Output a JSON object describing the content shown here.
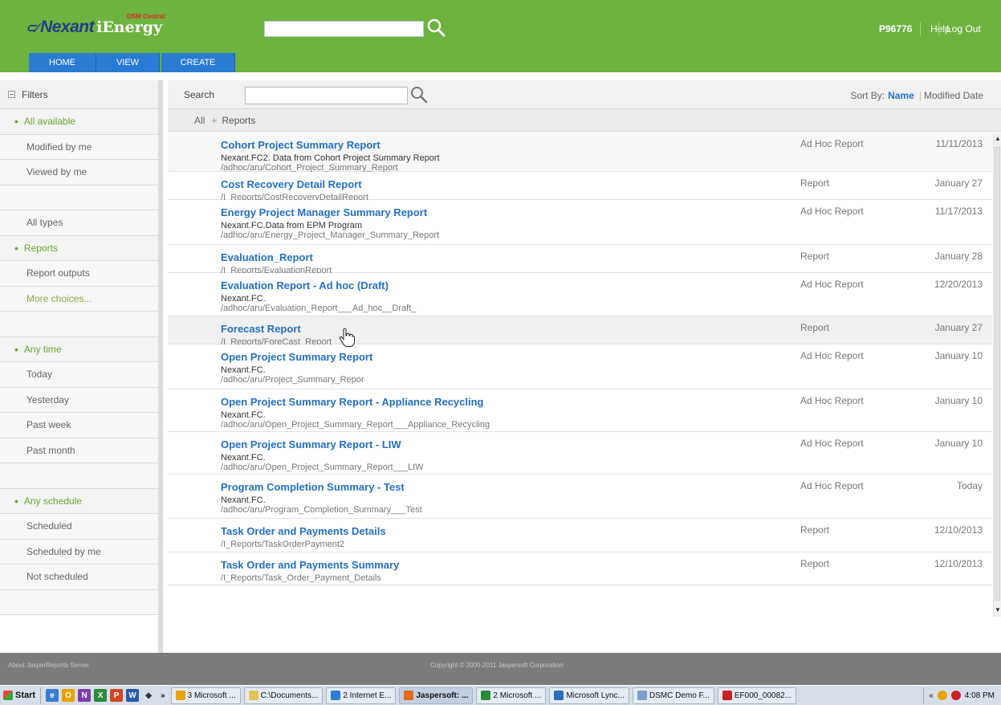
{
  "header": {
    "logo_brand": "Nexant",
    "logo_product": "iEnergy",
    "logo_tagline": "DSM Central",
    "user_id": "P96776",
    "help_label": "Help",
    "logout_label": "Log Out",
    "search_value": "",
    "brand_color": "#6db33f"
  },
  "tabs": [
    {
      "label": "HOME"
    },
    {
      "label": "VIEW"
    },
    {
      "label": "CREATE"
    }
  ],
  "filters": {
    "title": "Filters",
    "group1": [
      "All available",
      "Modified by me",
      "Viewed by me"
    ],
    "group2": [
      "All types",
      "Reports",
      "Report outputs",
      "More choices..."
    ],
    "group3": [
      "Any time",
      "Today",
      "Yesterday",
      "Past week",
      "Past month"
    ],
    "group4": [
      "Any schedule",
      "Scheduled",
      "Scheduled by me",
      "Not scheduled"
    ],
    "selected": [
      "All available",
      "Reports",
      "Any time",
      "Any schedule"
    ]
  },
  "main": {
    "search_label": "Search",
    "search_value": "",
    "sort_by_label": "Sort By:",
    "sort_name": "Name",
    "sort_modified": "Modified Date",
    "breadcrumb_all": "All",
    "breadcrumb_sep": "+",
    "breadcrumb_current": "Reports"
  },
  "reports": [
    {
      "title": "Cohort Project Summary Report",
      "desc": "Nexant.FC2. Data from Cohort Project Summary Report",
      "path": "/adhoc/aru/Cohort_Project_Summary_Report",
      "type": "Ad Hoc Report",
      "date": "11/11/2013"
    },
    {
      "title": "Cost Recovery Detail Report",
      "desc": "",
      "path": "/I_Reports/CostRecoveryDetailReport",
      "type": "Report",
      "date": "January 27"
    },
    {
      "title": "Energy Project Manager Summary Report",
      "desc": "Nexant.FC.Data from EPM Program",
      "path": "/adhoc/aru/Energy_Project_Manager_Summary_Report",
      "type": "Ad Hoc Report",
      "date": "11/17/2013"
    },
    {
      "title": "Evaluation_Report",
      "desc": "",
      "path": "/I_Reports/EvaluationReport",
      "type": "Report",
      "date": "January 28"
    },
    {
      "title": "Evaluation Report - Ad hoc (Draft)",
      "desc": "Nexant.FC.",
      "path": "/adhoc/aru/Evaluation_Report___Ad_hoc__Draft_",
      "type": "Ad Hoc Report",
      "date": "12/20/2013"
    },
    {
      "title": "Forecast Report",
      "desc": "",
      "path": "/I_Reports/ForeCast_Report",
      "type": "Report",
      "date": "January 27"
    },
    {
      "title": "Open Project Summary Report",
      "desc": "Nexant.FC.",
      "path": "/adhoc/aru/Project_Summary_Repor",
      "type": "Ad Hoc Report",
      "date": "January 10"
    },
    {
      "title": "Open Project Summary Report - Appliance Recycling",
      "desc": "Nexant.FC.",
      "path": "/adhoc/aru/Open_Project_Summary_Report___Appliance_Recycling",
      "type": "Ad Hoc Report",
      "date": "January 10"
    },
    {
      "title": "Open Project Summary Report - LIW",
      "desc": "Nexant.FC.",
      "path": "/adhoc/aru/Open_Project_Summary_Report___LIW",
      "type": "Ad Hoc Report",
      "date": "January 10"
    },
    {
      "title": "Program Completion Summary - Test",
      "desc": "Nexant.FC.",
      "path": "/adhoc/aru/Program_Completion_Summary___Test",
      "type": "Ad Hoc Report",
      "date": "Today"
    },
    {
      "title": "Task Order and Payments Details",
      "desc": "",
      "path": "/I_Reports/TaskOrderPayment2",
      "type": "Report",
      "date": "12/10/2013"
    },
    {
      "title": "Task Order and Payments Summary",
      "desc": "",
      "path": "/I_Reports/Task_Order_Payment_Details",
      "type": "Report",
      "date": "12/10/2013"
    }
  ],
  "footer": {
    "about": "About JasperReports Server",
    "copyright": "Copyright © 2000-2011 Jaspersoft Corporation"
  },
  "taskbar": {
    "start_label": "Start",
    "overflow": "»",
    "buttons": [
      {
        "label": "3 Microsoft ...",
        "icon_color": "#e8a400"
      },
      {
        "label": "C:\\Documents...",
        "icon_color": "#e3c15a"
      },
      {
        "label": "2 Internet E...",
        "icon_color": "#2f7fd8"
      },
      {
        "label": "Jaspersoft: ...",
        "icon_color": "#e06a1b",
        "active": true
      },
      {
        "label": "2 Microsoft ...",
        "icon_color": "#2c8a3a"
      },
      {
        "label": "Microsoft Lync...",
        "icon_color": "#2a6fbd"
      },
      {
        "label": "DSMC Demo F...",
        "icon_color": "#7aa0d0"
      },
      {
        "label": "EF000_00082...",
        "icon_color": "#c8202a"
      }
    ],
    "tray_chevron": "«",
    "clock": "4:08 PM"
  }
}
